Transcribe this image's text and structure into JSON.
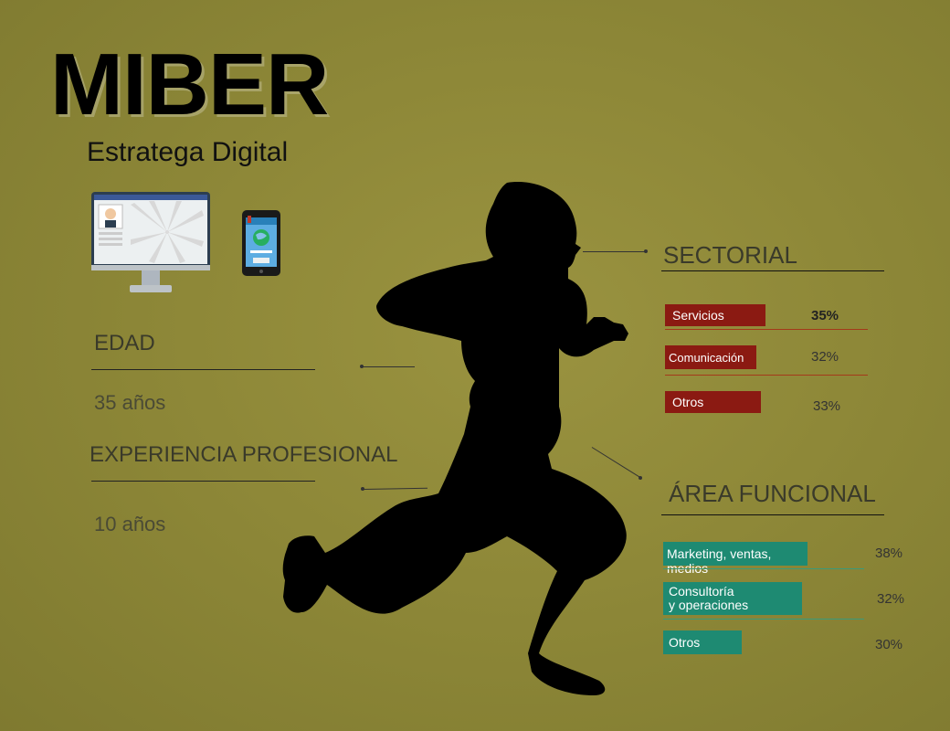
{
  "header": {
    "title": "MIBER",
    "subtitle": "Estratega Digital"
  },
  "left": {
    "age_label": "EDAD",
    "age_value": "35 años",
    "exp_label": "EXPERIENCIA PROFESIONAL",
    "exp_value": "10 años"
  },
  "sectorial": {
    "title": "SECTORIAL",
    "items": [
      {
        "label": "Servicios",
        "value": "35%"
      },
      {
        "label": "Comunicación",
        "value": "32%"
      },
      {
        "label": "Otros",
        "value": "33%"
      }
    ]
  },
  "funcional": {
    "title": "ÁREA FUNCIONAL",
    "items": [
      {
        "label": "Marketing, ventas, medios",
        "value": "38%"
      },
      {
        "label": "Consultoría\ny operaciones",
        "value": "32%"
      },
      {
        "label": "Otros",
        "value": "30%"
      }
    ]
  },
  "colors": {
    "background": "#8e8838",
    "sector_bar": "#8b1a12",
    "function_bar": "#1e8a72",
    "silhouette": "#000000"
  },
  "icons": [
    "desktop-monitor-icon",
    "smartphone-icon",
    "runner-silhouette"
  ]
}
